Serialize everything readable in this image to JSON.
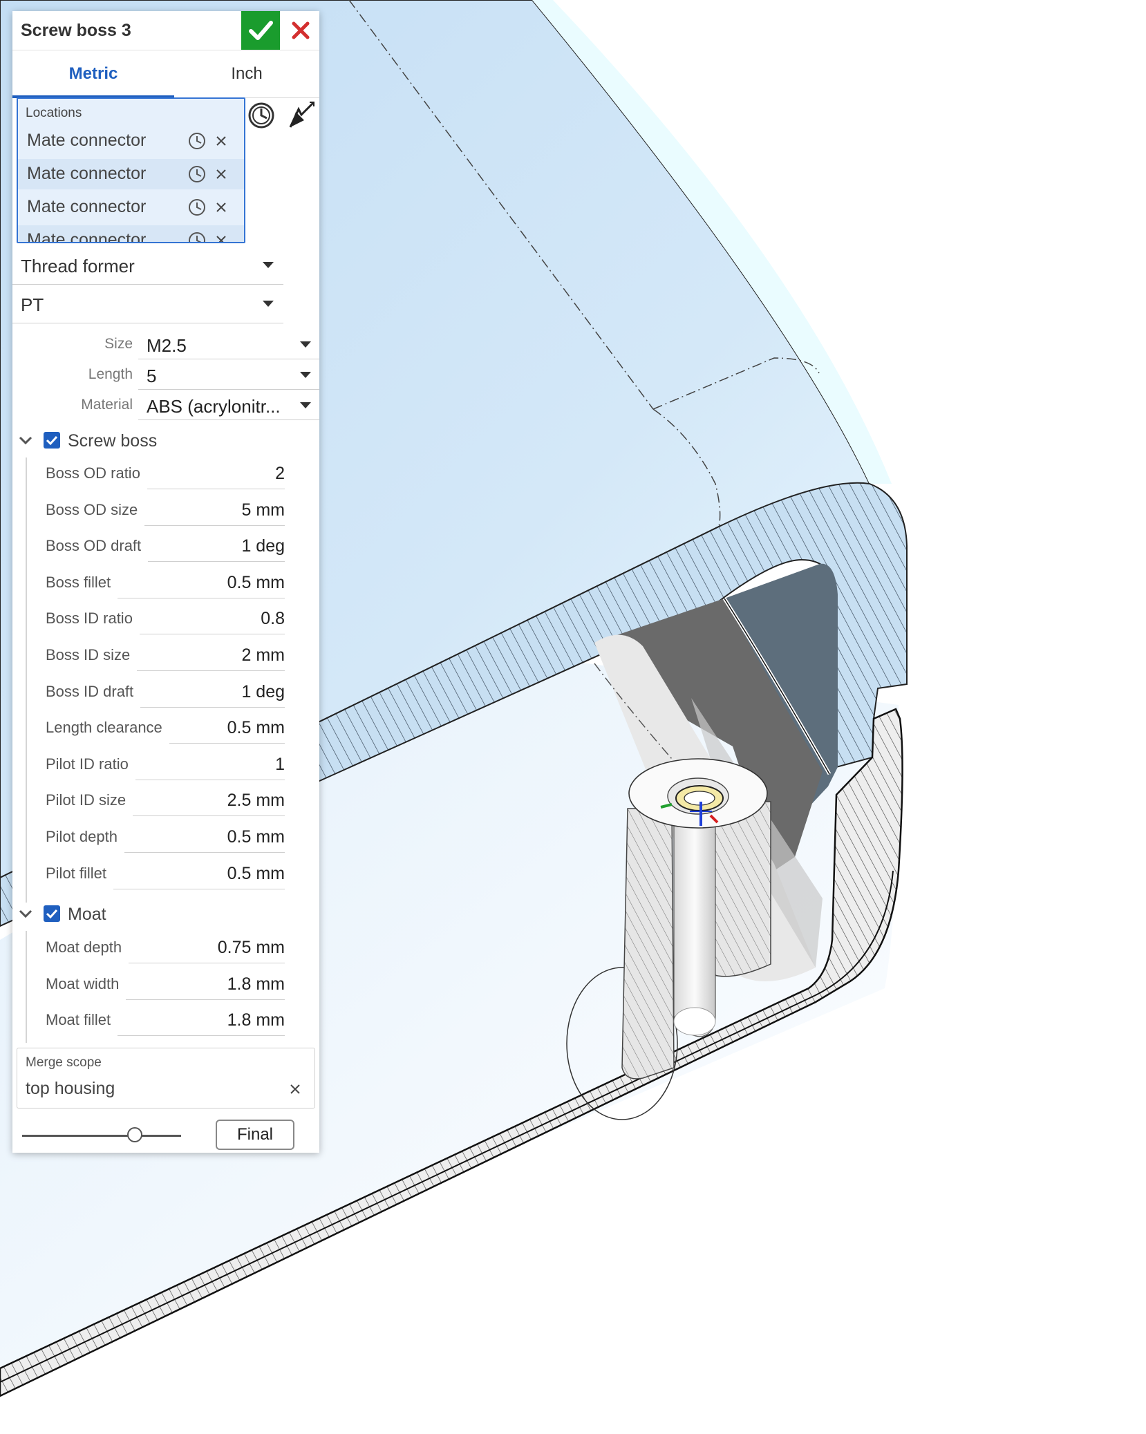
{
  "dialog": {
    "title": "Screw boss 3",
    "ok_icon": "checkmark-icon",
    "cancel_icon": "close-icon"
  },
  "tabs": [
    {
      "label": "Metric",
      "active": true
    },
    {
      "label": "Inch",
      "active": false
    }
  ],
  "locations": {
    "title": "Locations",
    "items": [
      "Mate connector",
      "Mate connector",
      "Mate connector",
      "Mate connector"
    ]
  },
  "thread_type": "Thread former",
  "standard": "PT",
  "size": {
    "label": "Size",
    "value": "M2.5"
  },
  "length": {
    "label": "Length",
    "value": "5"
  },
  "material": {
    "label": "Material",
    "value": "ABS (acrylonitr..."
  },
  "screw_boss": {
    "label": "Screw boss",
    "checked": true,
    "rows": [
      {
        "label": "Boss OD ratio",
        "value": "2"
      },
      {
        "label": "Boss OD size",
        "value": "5 mm"
      },
      {
        "label": "Boss OD draft",
        "value": "1 deg"
      },
      {
        "label": "Boss fillet",
        "value": "0.5 mm"
      },
      {
        "label": "Boss ID ratio",
        "value": "0.8"
      },
      {
        "label": "Boss ID size",
        "value": "2 mm"
      },
      {
        "label": "Boss ID draft",
        "value": "1 deg"
      },
      {
        "label": "Length clearance",
        "value": "0.5 mm"
      },
      {
        "label": "Pilot ID ratio",
        "value": "1"
      },
      {
        "label": "Pilot ID size",
        "value": "2.5 mm"
      },
      {
        "label": "Pilot depth",
        "value": "0.5 mm"
      },
      {
        "label": "Pilot fillet",
        "value": "0.5 mm"
      }
    ]
  },
  "moat": {
    "label": "Moat",
    "checked": true,
    "rows": [
      {
        "label": "Moat depth",
        "value": "0.75 mm"
      },
      {
        "label": "Moat width",
        "value": "1.8 mm"
      },
      {
        "label": "Moat fillet",
        "value": "1.8 mm"
      }
    ]
  },
  "merge_scope": {
    "title": "Merge scope",
    "value": "top housing"
  },
  "rollback": {
    "button": "Final",
    "position": 0.71
  },
  "colors": {
    "accent": "#1f5fbf",
    "ok": "#1a9c2d",
    "cancel": "#d32f2f",
    "selection_bg": "#e6f0fb",
    "model_face": "#cfe4f6",
    "section_hatch": "#555555"
  }
}
